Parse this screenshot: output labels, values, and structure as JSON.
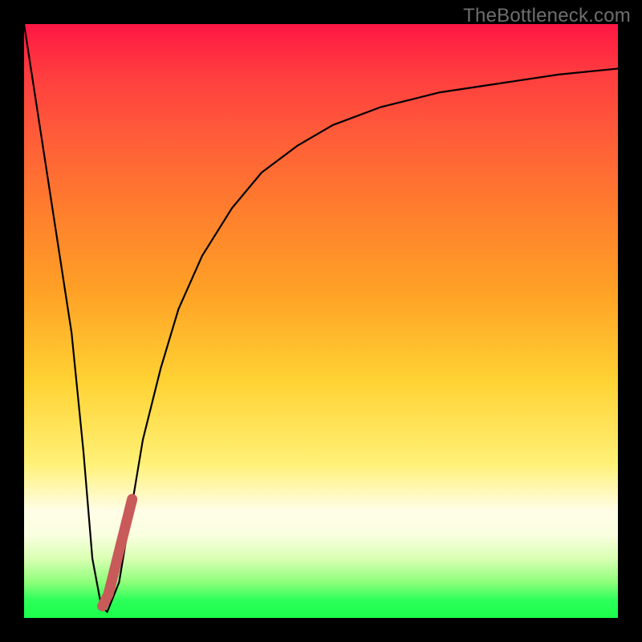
{
  "watermark": "TheBottleneck.com",
  "colors": {
    "background_frame": "#000000",
    "gradient_top": "#ff1744",
    "gradient_mid": "#ffd233",
    "gradient_light_band": "#fffde7",
    "gradient_bottom": "#1aff4a",
    "curve_stroke": "#000000",
    "marker_stroke": "#c85a5a"
  },
  "chart_data": {
    "type": "line",
    "title": "",
    "xlabel": "",
    "ylabel": "",
    "xlim": [
      0,
      100
    ],
    "ylim": [
      0,
      100
    ],
    "series": [
      {
        "name": "bottleneck-curve",
        "x": [
          0,
          2,
          4,
          6,
          8,
          10,
          11.5,
          13,
          14,
          16,
          18,
          20,
          23,
          26,
          30,
          35,
          40,
          46,
          52,
          60,
          70,
          80,
          90,
          100
        ],
        "y": [
          100,
          87,
          74,
          61,
          48,
          28,
          10,
          2,
          1,
          6,
          18,
          30,
          42,
          52,
          61,
          69,
          75,
          79.5,
          83,
          86,
          88.5,
          90,
          91.5,
          92.5
        ]
      },
      {
        "name": "highlight-segment",
        "x": [
          13.2,
          14.2,
          15.2,
          16.2,
          17.2,
          18.2
        ],
        "y": [
          2,
          4,
          8,
          12,
          16,
          20
        ]
      }
    ],
    "grid": false,
    "legend": false,
    "notes": "x and y are in percent of plot area; y=0 is bottom (green), y=100 is top (red). Values are estimated from pixel positions; no numeric axes are printed in the original image."
  }
}
